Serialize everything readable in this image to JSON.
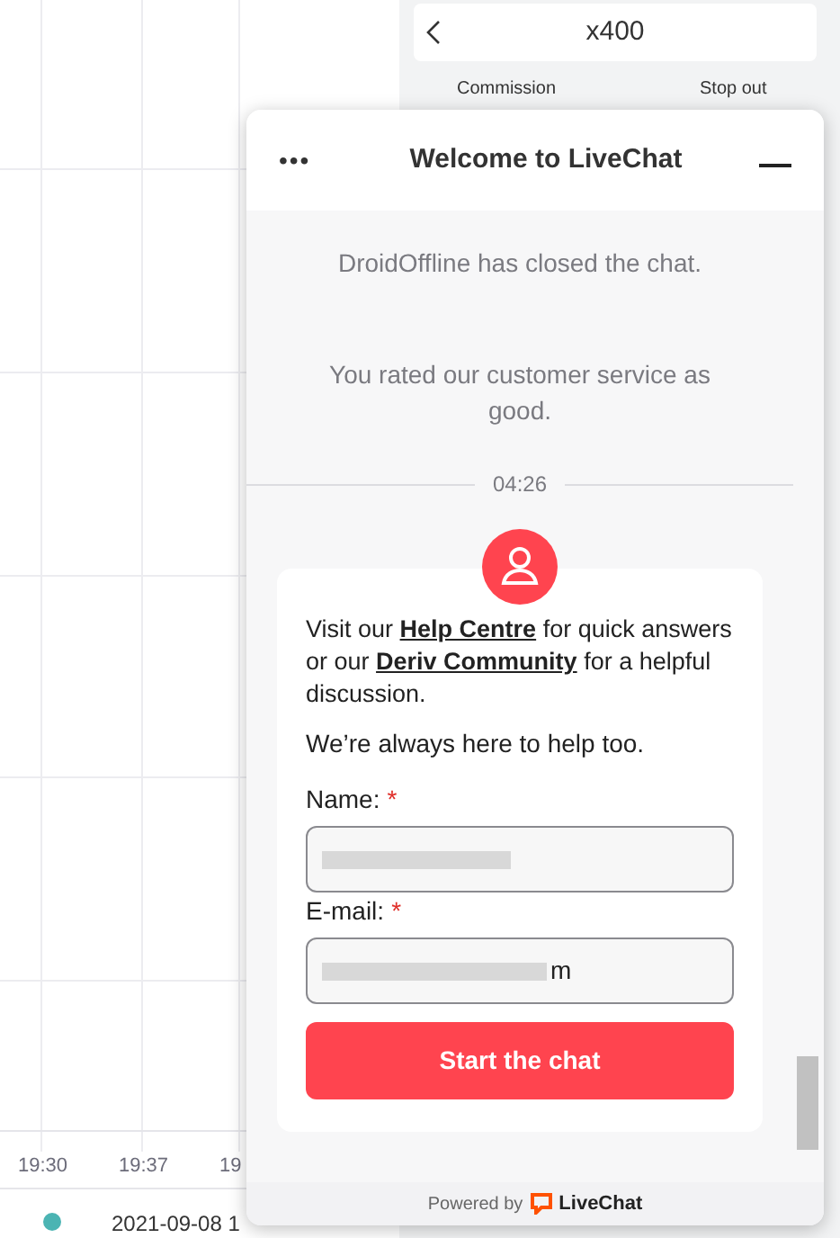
{
  "trade_panel": {
    "multiplier": "x400",
    "labels": [
      "Commission",
      "Stop out"
    ]
  },
  "chart": {
    "time_labels": [
      "19:30",
      "19:37",
      "19"
    ]
  },
  "status_bar": {
    "timestamp": "2021-09-08 1"
  },
  "chat": {
    "title": "Welcome to LiveChat",
    "menu_glyph": "•••",
    "messages": [
      "DroidOffline has closed the chat.",
      "You rated our customer service as good."
    ],
    "time": "04:26",
    "intro_parts": [
      "Visit our ",
      "Help Centre",
      " for quick answers or our ",
      "Deriv Community",
      " for a helpful discussion."
    ],
    "note": "We’re always here to help too.",
    "fields": [
      {
        "label": "Name:",
        "required_mark": "*"
      },
      {
        "label": "E-mail:",
        "required_mark": "*",
        "value_tail": "m"
      }
    ],
    "button": "Start the chat",
    "footer": {
      "text": "Powered by",
      "brand": "LiveChat"
    }
  }
}
